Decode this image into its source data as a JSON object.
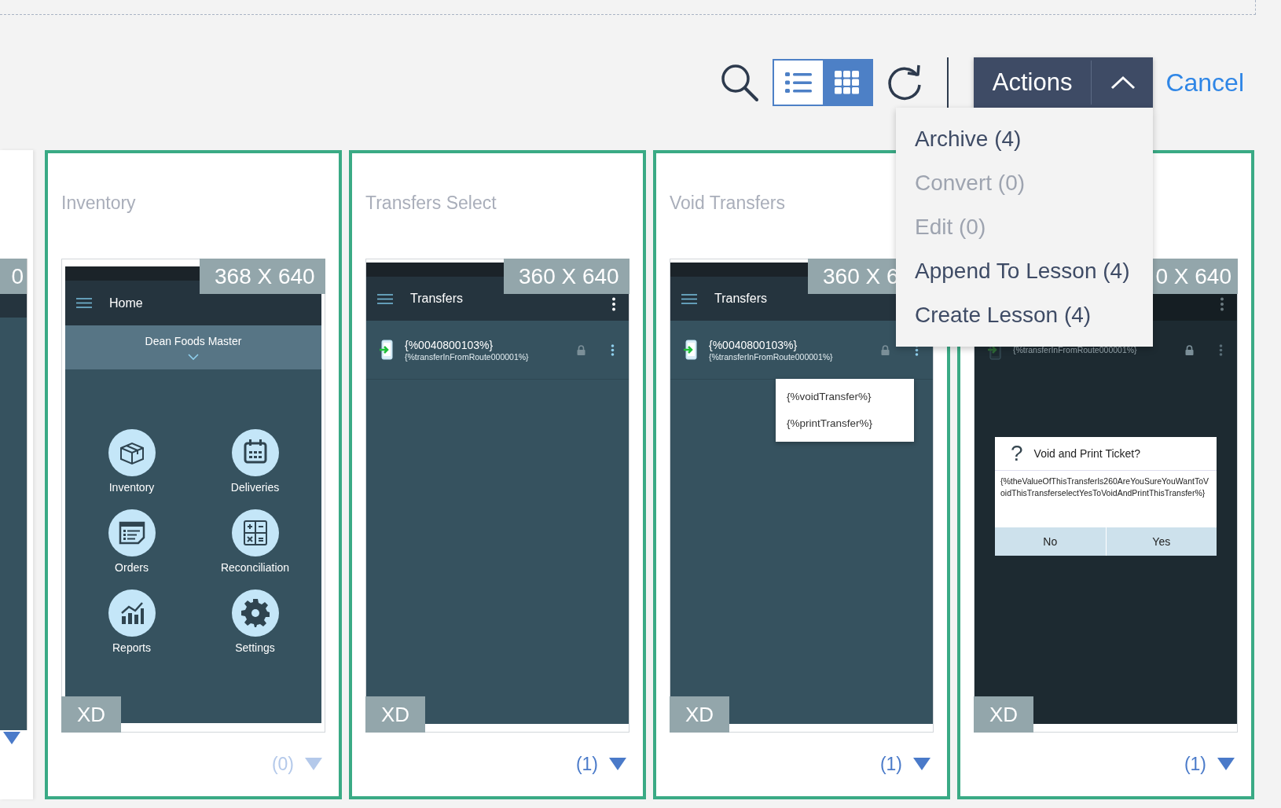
{
  "toolbar": {
    "views": [
      {
        "kind": "list",
        "selected": false
      },
      {
        "kind": "grid",
        "selected": true
      }
    ],
    "actions": {
      "label": "Actions",
      "expanded": true
    },
    "cancel": "Cancel"
  },
  "actions_menu": [
    {
      "label": "Archive (4)",
      "disabled": false
    },
    {
      "label": "Convert (0)",
      "disabled": true
    },
    {
      "label": "Edit (0)",
      "disabled": true
    },
    {
      "label": "Append To Lesson (4)",
      "disabled": false
    },
    {
      "label": "Create Lesson (4)",
      "disabled": false
    }
  ],
  "cards": [
    {
      "kind": "clipped",
      "selected": false,
      "size": "0",
      "footer_disabled": false
    },
    {
      "kind": "home",
      "selected": true,
      "title": "Inventory",
      "size": "368 X 640",
      "badge": "XD",
      "count": "(0)",
      "footer_disabled": true,
      "screen": {
        "app_title": "Home",
        "kebab": false,
        "subheader": "Dean Foods Master",
        "tiles": [
          {
            "kind": "box",
            "label": "Inventory"
          },
          {
            "kind": "calendar",
            "label": "Deliveries"
          },
          {
            "kind": "orders",
            "label": "Orders"
          },
          {
            "kind": "calculator",
            "label": "Reconciliation"
          },
          {
            "kind": "chart",
            "label": "Reports"
          },
          {
            "kind": "gear",
            "label": "Settings"
          }
        ]
      }
    },
    {
      "kind": "list",
      "selected": true,
      "title": "Transfers Select",
      "size": "360 X 640",
      "badge": "XD",
      "count": "(1)",
      "footer_disabled": false,
      "screen": {
        "app_title": "Transfers",
        "kebab": true,
        "rows": [
          {
            "title": "{%0040800103%}",
            "subtitle": "{%transferInFromRoute000001%}"
          }
        ]
      }
    },
    {
      "kind": "list",
      "selected": true,
      "title": "Void Transfers",
      "size": "360 X 6",
      "badge": "XD",
      "count": "(1)",
      "footer_disabled": false,
      "screen": {
        "app_title": "Transfers",
        "kebab": false,
        "rows": [
          {
            "title": "{%0040800103%}",
            "subtitle": "{%transferInFromRoute000001%}"
          }
        ],
        "popup_menu": [
          "{%voidTransfer%}",
          "{%printTransfer%}"
        ]
      }
    },
    {
      "kind": "list",
      "selected": true,
      "size": "0 X 640",
      "badge": "XD",
      "count": "(1)",
      "footer_disabled": false,
      "screen": {
        "kebab": true,
        "rows": [
          {
            "subtitle": "{%transferInFromRoute000001%}"
          }
        ],
        "dialog": {
          "icon": "?",
          "title": "Void and Print Ticket?",
          "body": "{%theValueOfThisTransferIs260AreYouSureYouWantToVoidThisTransferselectYesToVoidAndPrintThisTransfer%}",
          "buttons": [
            "No",
            "Yes"
          ]
        }
      }
    }
  ]
}
